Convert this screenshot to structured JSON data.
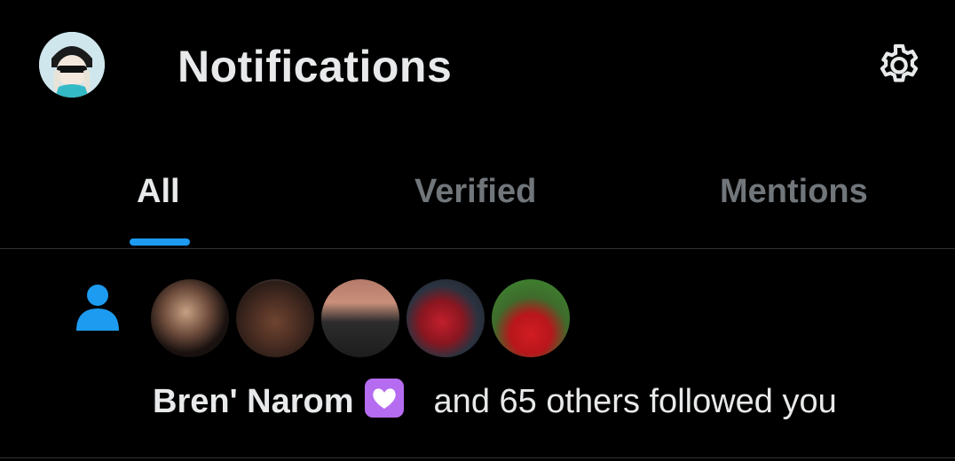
{
  "header": {
    "title": "Notifications",
    "avatar_icon": "user-avatar",
    "settings_icon": "gear-icon"
  },
  "tabs": [
    {
      "label": "All",
      "active": true
    },
    {
      "label": "Verified",
      "active": false
    },
    {
      "label": "Mentions",
      "active": false
    }
  ],
  "notification": {
    "type_icon": "person-icon",
    "follower_avatars": [
      "follower-avatar",
      "follower-avatar",
      "follower-avatar",
      "follower-avatar",
      "follower-avatar"
    ],
    "name": "Bren' Narom",
    "name_emoji": "purple-heart-emoji",
    "rest_text": "and 65 others followed you"
  },
  "colors": {
    "background": "#000000",
    "text_primary": "#e7e9ea",
    "text_secondary": "#71767b",
    "accent": "#1d9bf0",
    "divider": "#2f3336",
    "heart": "#b66cf0"
  }
}
